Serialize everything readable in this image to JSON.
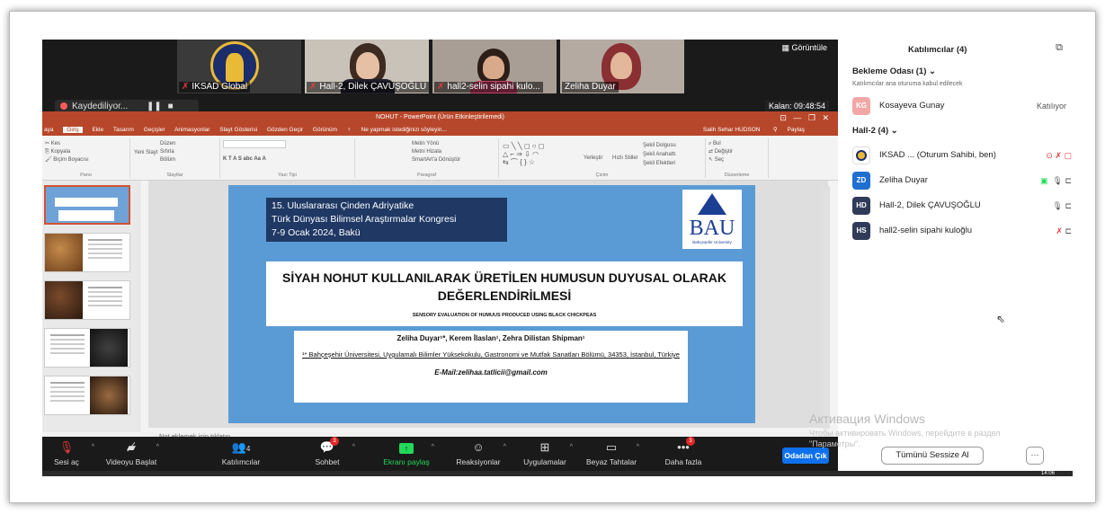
{
  "gallery": {
    "view_label": "Görüntüle",
    "tiles": [
      {
        "name": "IKSAD Global",
        "muted": true
      },
      {
        "name": "Hall-2, Dilek ÇAVUŞOĞLU",
        "muted": true
      },
      {
        "name": "hall2-selin sipahi kulo...",
        "muted": true
      },
      {
        "name": "Zeliha Duyar",
        "muted": false
      }
    ]
  },
  "recording": {
    "label": "Kaydediliyor..."
  },
  "timer": "Kalan: 09:48:54",
  "powerpoint": {
    "title": "NOHUT - PowerPoint (Ürün Etkinleştirilemedi)",
    "tabs": [
      "aya",
      "Giriş",
      "Ekle",
      "Tasarım",
      "Geçişler",
      "Animasyonlar",
      "Slayt Gösterisi",
      "Gözden Geçir",
      "Görünüm",
      "Ne yapmak istediğinizi söyleyin..."
    ],
    "user": "Salih Sehar HUDSON",
    "share": "Paylaş",
    "ribbon": {
      "pano": [
        "Kes",
        "Kopyala",
        "Biçim Boyacısı"
      ],
      "pano_label": "Pano",
      "slides": [
        "Yeni Slayt",
        "Düzen",
        "Sıfırla",
        "Bölüm"
      ],
      "slides_label": "Slaytlar",
      "font_label": "Yazı Tipi",
      "para": [
        "Metin Yönü",
        "Metni Hizala",
        "SmartArt'a Dönüştür"
      ],
      "para_label": "Paragraf",
      "draw": [
        "Yerleştir",
        "Hızlı Stiller",
        "Şekil Dolgusu",
        "Şekil Anahattı",
        "Şekil Efektleri"
      ],
      "draw_label": "Çizim",
      "edit": [
        "Bul",
        "Değiştir",
        "Seç"
      ],
      "edit_label": "Düzenleme"
    },
    "notes": "Not eklemek için tıklatın",
    "slide": {
      "conference": [
        "15. Uluslararası Çinden Adriyatike",
        "Türk Dünyası Bilimsel Araştırmalar Kongresi",
        "7-9 Ocak 2024, Bakü"
      ],
      "logo": "BAU",
      "logo_sub": "Bahçeşehir University",
      "title": "SİYAH NOHUT KULLANILARAK ÜRETİLEN HUMUSUN DUYUSAL OLARAK DEĞERLENDİRİLMESİ",
      "subtitle": "SENSORY EVALUATION OF HUMUUS PRODUCED USING BLACK CHICKPEAS",
      "authors": "Zeliha Duyar¹*, Kerem İlaslan¹, Zehra Dilistan Shipman¹",
      "affiliation": "¹* Bahçeşehir Üniversitesi, Uygulamalı Bilimler Yüksekokulu, Gastronomi ve Mutfak Sanatları Bölümü, 34353, İstanbul, Türkiye",
      "email": "E-Mail:zelihaa.tatlicii@gmail.com"
    }
  },
  "toolbar": {
    "items": [
      {
        "label": "Sesi aç",
        "icon": "mic-off-icon"
      },
      {
        "label": "Videoyu Başlat",
        "icon": "video-off-icon"
      },
      {
        "label": "Katılımcılar",
        "icon": "participants-icon",
        "count": "4"
      },
      {
        "label": "Sohbet",
        "icon": "chat-icon",
        "badge": "3"
      },
      {
        "label": "Ekranı paylaş",
        "icon": "share-screen-icon"
      },
      {
        "label": "Reaksiyonlar",
        "icon": "reactions-icon"
      },
      {
        "label": "Uygulamalar",
        "icon": "apps-icon"
      },
      {
        "label": "Beyaz Tahtalar",
        "icon": "whiteboard-icon"
      },
      {
        "label": "Daha fazla",
        "icon": "more-icon",
        "badge": "3"
      }
    ],
    "leave": "Odadan Çık"
  },
  "participants": {
    "title": "Katılımcılar (4)",
    "waiting": {
      "header": "Bekleme Odası (1)",
      "hint": "Katılımcılar ana oturuma kabul edilecek"
    },
    "waiting_list": [
      {
        "initials": "KG",
        "name": "Kosayeva Gunay",
        "status": "Katılıyor",
        "color": "#f2a7a7"
      }
    ],
    "hall": {
      "header": "Hall-2 (4)"
    },
    "hall_list": [
      {
        "initials": "",
        "name": "IKSAD ... (Oturum Sahibi, ben)",
        "color": "#ffffff"
      },
      {
        "initials": "ZD",
        "name": "Zeliha Duyar",
        "color": "#1f6fd1"
      },
      {
        "initials": "HD",
        "name": "Hall-2, Dilek ÇAVUŞOĞLU",
        "color": "#2f3b58"
      },
      {
        "initials": "HS",
        "name": "hall2-selin sipahi kuloğlu",
        "color": "#2f3b58"
      }
    ],
    "mute_all": "Tümünü Sessize Al",
    "more": "···"
  },
  "windows": {
    "activate": "Активация Windows",
    "activate_sub": "Чтобы активировать Windows, перейдите в раздел \"Параметры\".",
    "clock": "14:06"
  }
}
